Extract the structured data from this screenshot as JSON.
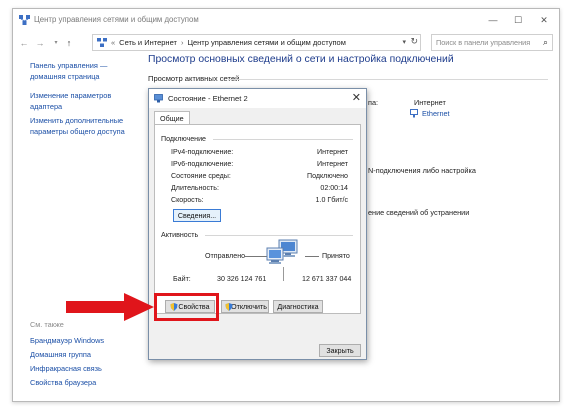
{
  "window": {
    "title": "Центр управления сетями и общим доступом",
    "controls": [
      "—",
      "☐",
      "✕"
    ]
  },
  "address": {
    "crumb1": "Сеть и Интернет",
    "crumb2": "Центр управления сетями и общим доступом",
    "search_placeholder": "Поиск в панели управления"
  },
  "sidebar": {
    "items": [
      {
        "label": "Панель управления —"
      },
      {
        "label": "домашняя страница"
      },
      {
        "label": "Изменение параметров"
      },
      {
        "label": "адаптера"
      },
      {
        "label": "Изменить дополнительные"
      },
      {
        "label": "параметры общего доступа"
      }
    ],
    "see_also": {
      "heading": "См. также",
      "items": [
        {
          "label": "Брандмауэр Windows"
        },
        {
          "label": "Домашняя группа"
        },
        {
          "label": "Инфракрасная связь"
        },
        {
          "label": "Свойства браузера"
        }
      ]
    }
  },
  "main": {
    "title": "Просмотр основных сведений о сети и настройка подключений",
    "subtitle": "Просмотр активных сетей",
    "access_label": "па:",
    "access_value": "Интернет",
    "connection_label": "Ethernet",
    "bg_line1": "N-подключения либо настройка",
    "bg_line2": "ение сведений об устранении"
  },
  "dialog": {
    "title": "Состояние - Ethernet 2",
    "tab": "Общие",
    "connection_group": "Подключение",
    "rows": [
      {
        "key": "IPv4-подключение:",
        "value": "Интернет"
      },
      {
        "key": "IPv6-подключение:",
        "value": "Интернет"
      },
      {
        "key": "Состояние среды:",
        "value": "Подключено"
      },
      {
        "key": "Длительность:",
        "value": "02:00:14"
      },
      {
        "key": "Скорость:",
        "value": "1.0 Гбит/с"
      }
    ],
    "details_button": "Сведения...",
    "activity_group": "Активность",
    "sent_label": "Отправлено",
    "received_label": "Принято",
    "bytes_label": "Байт:",
    "bytes_sent": "30 326 124 761",
    "bytes_received": "12 671 337 044",
    "properties_button": "Свойства",
    "disable_button": "Отключить",
    "diagnose_button": "Диагностика",
    "close_button": "Закрыть"
  },
  "colors": {
    "link": "#1b4fa6",
    "title": "#1e3c8c",
    "highlight": "#e0151b"
  }
}
